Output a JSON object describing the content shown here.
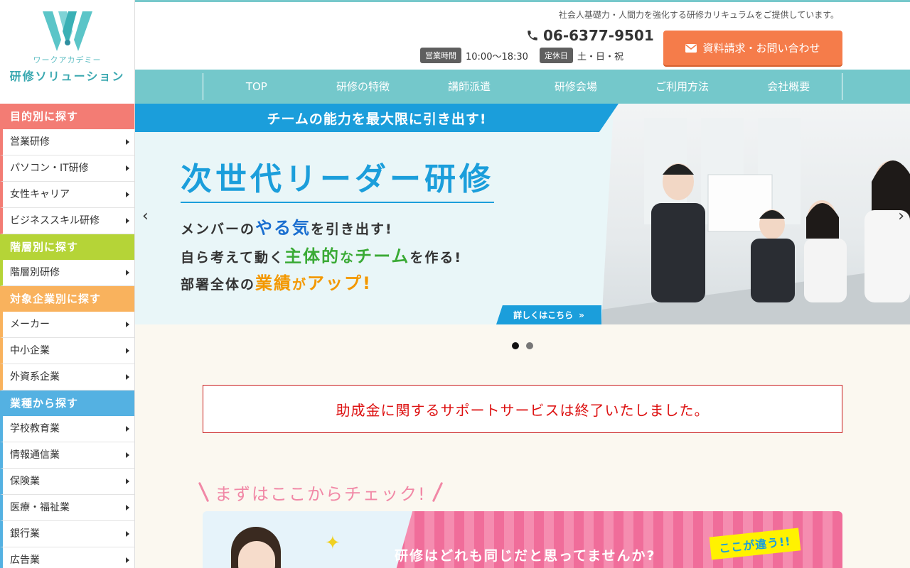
{
  "logo": {
    "sub": "ワークアカデミー",
    "main": "研修ソリューション"
  },
  "colors": {
    "teal": "#74c8cb",
    "orange": "#f57c4a",
    "blue": "#1b9edb",
    "pink": "#f188a6",
    "red": "#d11"
  },
  "sidebar": {
    "sections": [
      {
        "title": "目的別に探す",
        "items": [
          "営業研修",
          "パソコン・IT研修",
          "女性キャリア",
          "ビジネススキル研修"
        ]
      },
      {
        "title": "階層別に探す",
        "items": [
          "階層別研修"
        ]
      },
      {
        "title": "対象企業別に探す",
        "items": [
          "メーカー",
          "中小企業",
          "外資系企業"
        ]
      },
      {
        "title": "業種から探す",
        "items": [
          "学校教育業",
          "情報通信業",
          "保険業",
          "医療・福祉業",
          "銀行業",
          "広告業"
        ]
      }
    ]
  },
  "header": {
    "tagline": "社会人基礎力・人間力を強化する研修カリキュラムをご提供しています。",
    "phone": "06-6377-9501",
    "hours_label": "営業時間",
    "hours": "10:00〜18:30",
    "closed_label": "定休日",
    "closed": "土・日・祝",
    "contact_button": "資料請求・お問い合わせ"
  },
  "nav": [
    "TOP",
    "研修の特徴",
    "講師派遣",
    "研修会場",
    "ご利用方法",
    "会社概要"
  ],
  "hero": {
    "banner": "チームの能力を最大限に引き出す!",
    "title": "次世代リーダー研修",
    "line1_a": "メンバーの",
    "line1_em": "やる気",
    "line1_b": "を引き出す!",
    "line2_a": "自ら考えて動く",
    "line2_em1": "主体的",
    "line2_b": "な",
    "line2_em2": "チーム",
    "line2_c": "を作る!",
    "line3_a": "部署全体の",
    "line3_em1": "業績",
    "line3_b": "が",
    "line3_em2": "アップ!",
    "more": "詳しくはこちら",
    "more_arrow": "»",
    "prev": "‹",
    "next": "›"
  },
  "slider": {
    "count": 2,
    "active": 1
  },
  "notice": "助成金に関するサポートサービスは終了いたしました。",
  "check": {
    "heading": "まずはここからチェック!",
    "banner_text": "研修はどれも同じだと思ってませんか?",
    "badge": "ここが違う!!"
  }
}
